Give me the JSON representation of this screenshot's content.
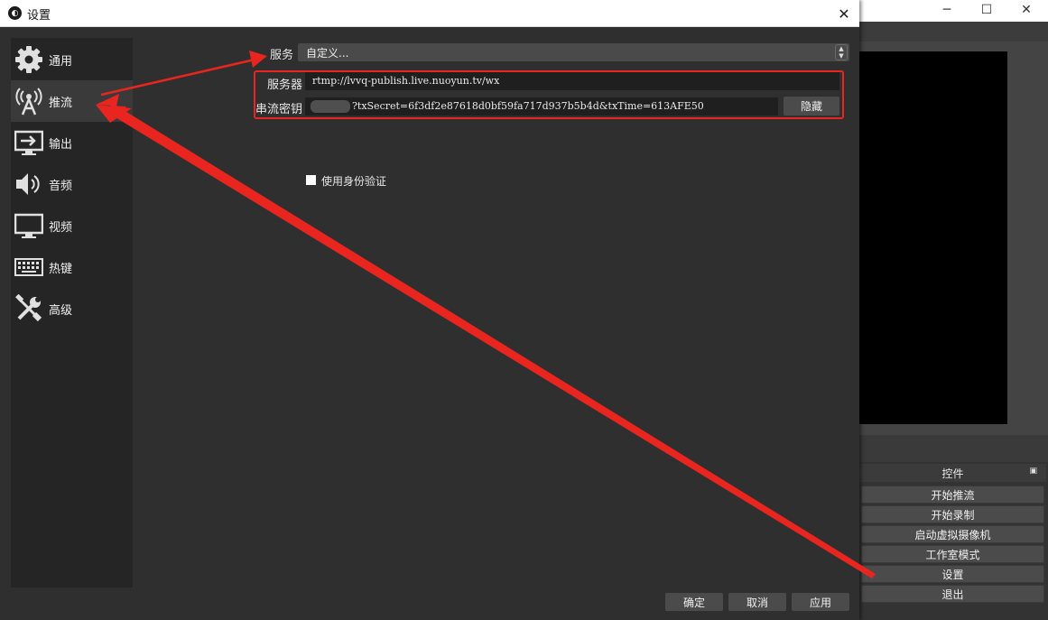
{
  "main_window": {
    "controls": {
      "title": "控件",
      "buttons": [
        "开始推流",
        "开始录制",
        "启动虚拟摄像机",
        "工作室模式",
        "设置",
        "退出"
      ]
    }
  },
  "dialog": {
    "title": "设置",
    "sidebar": {
      "items": [
        {
          "label": "通用",
          "icon": "gear-icon"
        },
        {
          "label": "推流",
          "icon": "broadcast-antenna-icon",
          "active": true
        },
        {
          "label": "输出",
          "icon": "output-icon"
        },
        {
          "label": "音频",
          "icon": "speaker-icon"
        },
        {
          "label": "视频",
          "icon": "monitor-icon"
        },
        {
          "label": "热键",
          "icon": "keyboard-icon"
        },
        {
          "label": "高级",
          "icon": "tools-icon"
        }
      ]
    },
    "stream": {
      "service_label": "服务",
      "service_value": "自定义...",
      "server_label": "服务器",
      "server_value": "rtmp://lvvq-publish.live.nuoyun.tv/wx",
      "key_label": "串流密钥",
      "key_value": "?txSecret=6f3df2e87618d0bf59fa717d937b5b4d&txTime=613AFE50",
      "hide_button": "隐藏",
      "auth_checkbox_label": "使用身份验证",
      "auth_checked": false
    },
    "footer": {
      "ok": "确定",
      "cancel": "取消",
      "apply": "应用"
    }
  },
  "colors": {
    "annotation_red": "#e8251f",
    "dialog_bg": "#2f2f2f",
    "sidebar_bg": "#252525"
  }
}
